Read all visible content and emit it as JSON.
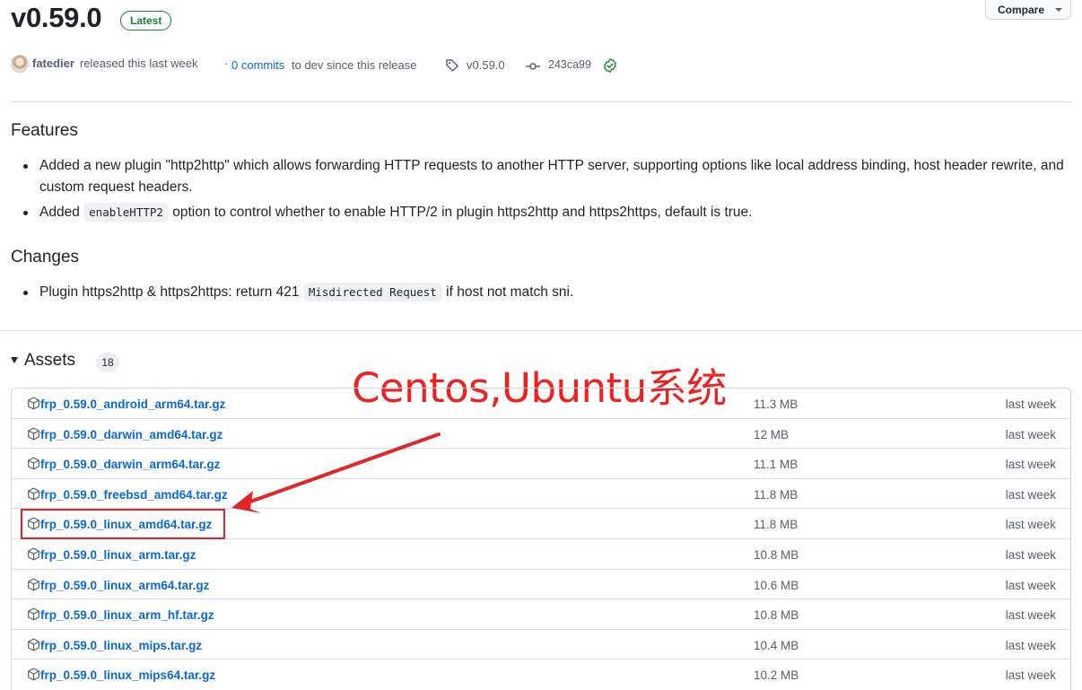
{
  "release": {
    "version": "v0.59.0",
    "latest_label": "Latest",
    "compare_label": "Compare",
    "author": "fatedier",
    "released_text": "released this last week",
    "separator": "·",
    "commits_link": "0 commits",
    "commits_rest": "to dev since this release",
    "tag": "v0.59.0",
    "commit_sha": "243ca99"
  },
  "sections": {
    "features_title": "Features",
    "feature_1": "Added a new plugin \"http2http\" which allows forwarding HTTP requests to another HTTP server, supporting options like local address binding, host header rewrite, and custom request headers.",
    "feature_2_pre": "Added",
    "feature_2_code": "enableHTTP2",
    "feature_2_post": "option to control whether to enable HTTP/2 in plugin https2http and https2https, default is true.",
    "changes_title": "Changes",
    "change_1_pre": "Plugin https2http & https2https: return 421",
    "change_1_code": "Misdirected Request",
    "change_1_post": "if host not match sni."
  },
  "assets": {
    "title": "Assets",
    "count": "18",
    "items": [
      {
        "name": "frp_0.59.0_android_arm64.tar.gz",
        "size": "11.3 MB",
        "date": "last week"
      },
      {
        "name": "frp_0.59.0_darwin_amd64.tar.gz",
        "size": "12 MB",
        "date": "last week"
      },
      {
        "name": "frp_0.59.0_darwin_arm64.tar.gz",
        "size": "11.1 MB",
        "date": "last week"
      },
      {
        "name": "frp_0.59.0_freebsd_amd64.tar.gz",
        "size": "11.8 MB",
        "date": "last week"
      },
      {
        "name": "frp_0.59.0_linux_amd64.tar.gz",
        "size": "11.8 MB",
        "date": "last week"
      },
      {
        "name": "frp_0.59.0_linux_arm.tar.gz",
        "size": "10.8 MB",
        "date": "last week"
      },
      {
        "name": "frp_0.59.0_linux_arm64.tar.gz",
        "size": "10.6 MB",
        "date": "last week"
      },
      {
        "name": "frp_0.59.0_linux_arm_hf.tar.gz",
        "size": "10.8 MB",
        "date": "last week"
      },
      {
        "name": "frp_0.59.0_linux_mips.tar.gz",
        "size": "10.4 MB",
        "date": "last week"
      },
      {
        "name": "frp_0.59.0_linux_mips64.tar.gz",
        "size": "10.2 MB",
        "date": "last week"
      }
    ]
  },
  "annotation": {
    "text": "Centos,Ubuntu系统",
    "color": "#ee2020"
  },
  "colors": {
    "link": "#0969da",
    "latest": "#1a7f37",
    "muted": "#57606a"
  }
}
